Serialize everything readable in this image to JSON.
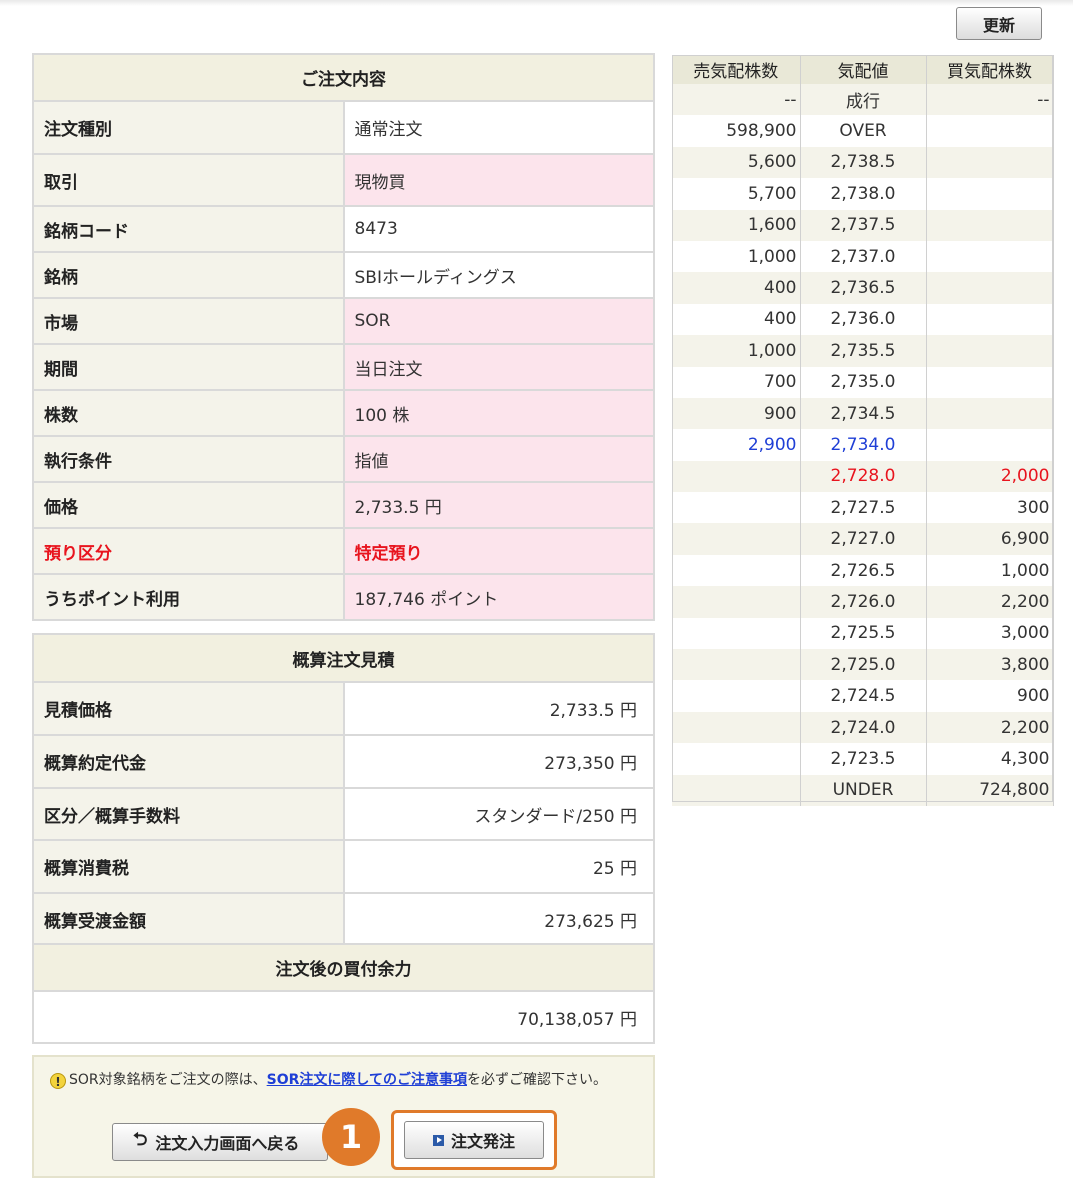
{
  "header": {
    "refresh_label": "更新"
  },
  "order": {
    "title": "ご注文内容",
    "rows": [
      {
        "label": "注文種別",
        "value": "通常注文"
      },
      {
        "label": "取引",
        "value": "現物買"
      },
      {
        "label": "銘柄コード",
        "value": "8473"
      },
      {
        "label": "銘柄",
        "value": "SBIホールディングス"
      },
      {
        "label": "市場",
        "value": "SOR"
      },
      {
        "label": "期間",
        "value": "当日注文"
      },
      {
        "label": "株数",
        "value": "100 株"
      },
      {
        "label": "執行条件",
        "value": "指値"
      },
      {
        "label": "価格",
        "value": "2,733.5 円"
      },
      {
        "label": "預り区分",
        "value": "特定預り"
      },
      {
        "label": "うちポイント利用",
        "value": "187,746 ポイント"
      }
    ]
  },
  "estimate": {
    "title": "概算注文見積",
    "rows": [
      {
        "label": "見積価格",
        "value": "2,733.5 円"
      },
      {
        "label": "概算約定代金",
        "value": "273,350 円"
      },
      {
        "label": "区分／概算手数料",
        "value": "スタンダード/250 円"
      },
      {
        "label": "概算消費税",
        "value": "25 円"
      },
      {
        "label": "概算受渡金額",
        "value": "273,625 円"
      }
    ]
  },
  "buying_power": {
    "title": "注文後の買付余力",
    "value": "70,138,057 円"
  },
  "board": {
    "headers": [
      "売気配株数",
      "気配値",
      "買気配株数"
    ],
    "rows": [
      {
        "sell": "--",
        "price": "成行",
        "buy": "--"
      },
      {
        "sell": "598,900",
        "price": "OVER",
        "buy": ""
      },
      {
        "sell": "5,600",
        "price": "2,738.5",
        "buy": ""
      },
      {
        "sell": "5,700",
        "price": "2,738.0",
        "buy": ""
      },
      {
        "sell": "1,600",
        "price": "2,737.5",
        "buy": ""
      },
      {
        "sell": "1,000",
        "price": "2,737.0",
        "buy": ""
      },
      {
        "sell": "400",
        "price": "2,736.5",
        "buy": ""
      },
      {
        "sell": "400",
        "price": "2,736.0",
        "buy": ""
      },
      {
        "sell": "1,000",
        "price": "2,735.5",
        "buy": ""
      },
      {
        "sell": "700",
        "price": "2,735.0",
        "buy": ""
      },
      {
        "sell": "900",
        "price": "2,734.5",
        "buy": ""
      },
      {
        "sell": "2,900",
        "price": "2,734.0",
        "buy": ""
      },
      {
        "sell": "",
        "price": "2,728.0",
        "buy": "2,000"
      },
      {
        "sell": "",
        "price": "2,727.5",
        "buy": "300"
      },
      {
        "sell": "",
        "price": "2,727.0",
        "buy": "6,900"
      },
      {
        "sell": "",
        "price": "2,726.5",
        "buy": "1,000"
      },
      {
        "sell": "",
        "price": "2,726.0",
        "buy": "2,200"
      },
      {
        "sell": "",
        "price": "2,725.5",
        "buy": "3,000"
      },
      {
        "sell": "",
        "price": "2,725.0",
        "buy": "3,800"
      },
      {
        "sell": "",
        "price": "2,724.5",
        "buy": "900"
      },
      {
        "sell": "",
        "price": "2,724.0",
        "buy": "2,200"
      },
      {
        "sell": "",
        "price": "2,723.5",
        "buy": "4,300"
      },
      {
        "sell": "",
        "price": "UNDER",
        "buy": "724,800"
      }
    ]
  },
  "notice": {
    "prefix": "SOR対象銘柄をご注文の際は、",
    "link": "SOR注文に際してのご注意事項",
    "suffix": "を必ずご確認下さい。"
  },
  "actions": {
    "back_label": "注文入力画面へ戻る",
    "submit_label": "注文発注",
    "step_number": "1"
  },
  "colors": {
    "accent": "#e07a2a",
    "highlight_red": "#e8141e",
    "best_ask_blue": "#1f3fd6",
    "section_bg": "#f2f0e0",
    "pink_cell": "#fce4ec"
  },
  "icons": {
    "warning": "warning-icon",
    "back": "return-arrow-icon",
    "submit": "play-icon"
  }
}
